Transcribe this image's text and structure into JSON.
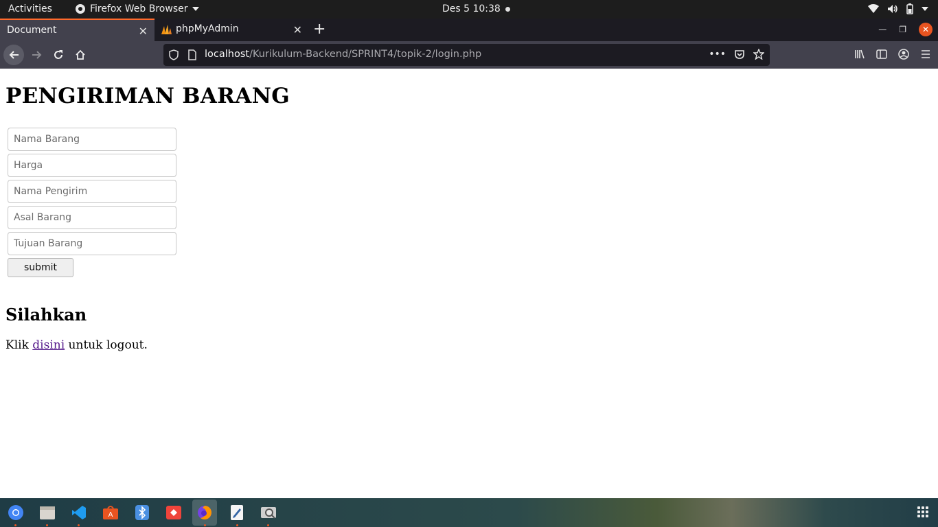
{
  "topbar": {
    "activities": "Activities",
    "app_menu": "Firefox Web Browser",
    "clock": "Des 5  10:38"
  },
  "browser": {
    "tabs": [
      {
        "label": "Document",
        "active": true
      },
      {
        "label": "phpMyAdmin",
        "active": false
      }
    ],
    "url_host": "localhost",
    "url_path": "/Kurikulum-Backend/SPRINT4/topik-2/login.php"
  },
  "page": {
    "title": "PENGIRIMAN BARANG",
    "fields": {
      "nama_barang": "Nama Barang",
      "harga": "Harga",
      "nama_pengirim": "Nama Pengirim",
      "asal_barang": "Asal Barang",
      "tujuan_barang": "Tujuan Barang"
    },
    "submit_label": "submit",
    "subtitle": "Silahkan",
    "logout_prefix": "Klik ",
    "logout_link": "disini",
    "logout_suffix": " untuk logout."
  },
  "dock": {
    "apps": [
      "chrome-icon",
      "files-icon",
      "vscode-icon",
      "software-icon",
      "bluetooth-icon",
      "anydesk-icon",
      "firefox-icon",
      "text-editor-icon",
      "screenshot-icon"
    ]
  },
  "colors": {
    "accent": "#e95420",
    "link_visited": "#551a8b",
    "chrome_dark": "#42414d"
  }
}
